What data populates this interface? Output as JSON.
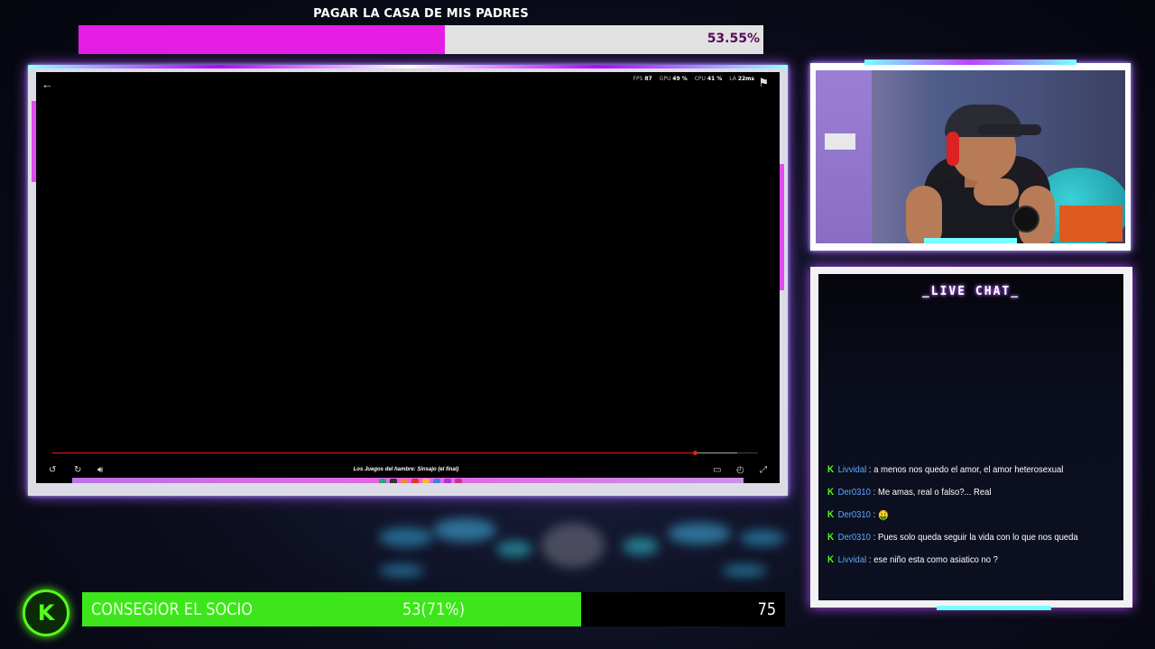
{
  "top_goal": {
    "title": "PAGAR LA CASA DE MIS PADRES",
    "percent_label": "53.55%",
    "progress_fraction": 0.5355,
    "fill_color": "#e51de5"
  },
  "player": {
    "back_icon": "arrow-left-icon",
    "report_icon": "flag-icon",
    "stats": [
      {
        "label": "FPS",
        "value": "87"
      },
      {
        "label": "GPU",
        "value": "49 %"
      },
      {
        "label": "CPU",
        "value": "41 %"
      },
      {
        "label": "LA",
        "value": "22ms"
      }
    ],
    "video_title": "Los Juegos del hambre: Sinsajo (el final)",
    "played_fraction": 0.91,
    "buffered_fraction": 0.97,
    "controls": {
      "rewind_icon": "rewind-10-icon",
      "forward_icon": "forward-10-icon",
      "volume_icon": "volume-icon",
      "subtitles_icon": "subtitles-icon",
      "speed_icon": "speed-icon",
      "fullscreen_icon": "fullscreen-icon"
    }
  },
  "webcam": {
    "label": "streamer-webcam"
  },
  "chat": {
    "title": "_LIVE CHAT_",
    "messages": [
      {
        "user": "Livvidal",
        "text": "a menos nos quedo el amor, el amor heterosexual"
      },
      {
        "user": "Der0310",
        "text": "Me amas, real o falso?... Real"
      },
      {
        "user": "Der0310",
        "text": "🤑"
      },
      {
        "user": "Der0310",
        "text": "Pues solo queda seguir la vida con lo que nos queda"
      },
      {
        "user": "Livvidal",
        "text": "ese niño esta como asiatico no ?"
      }
    ]
  },
  "sub_goal": {
    "logo_letter": "K",
    "title": "CONSEGIOR EL SOCIO",
    "progress_label": "53(71%)",
    "target_label": "75",
    "progress_fraction": 0.71,
    "fill_color": "#3de61a"
  },
  "colors": {
    "accent_pink": "#e04af0",
    "accent_cyan": "#77ffff",
    "kick_green": "#53fc18",
    "chat_username": "#5fa8ff"
  }
}
